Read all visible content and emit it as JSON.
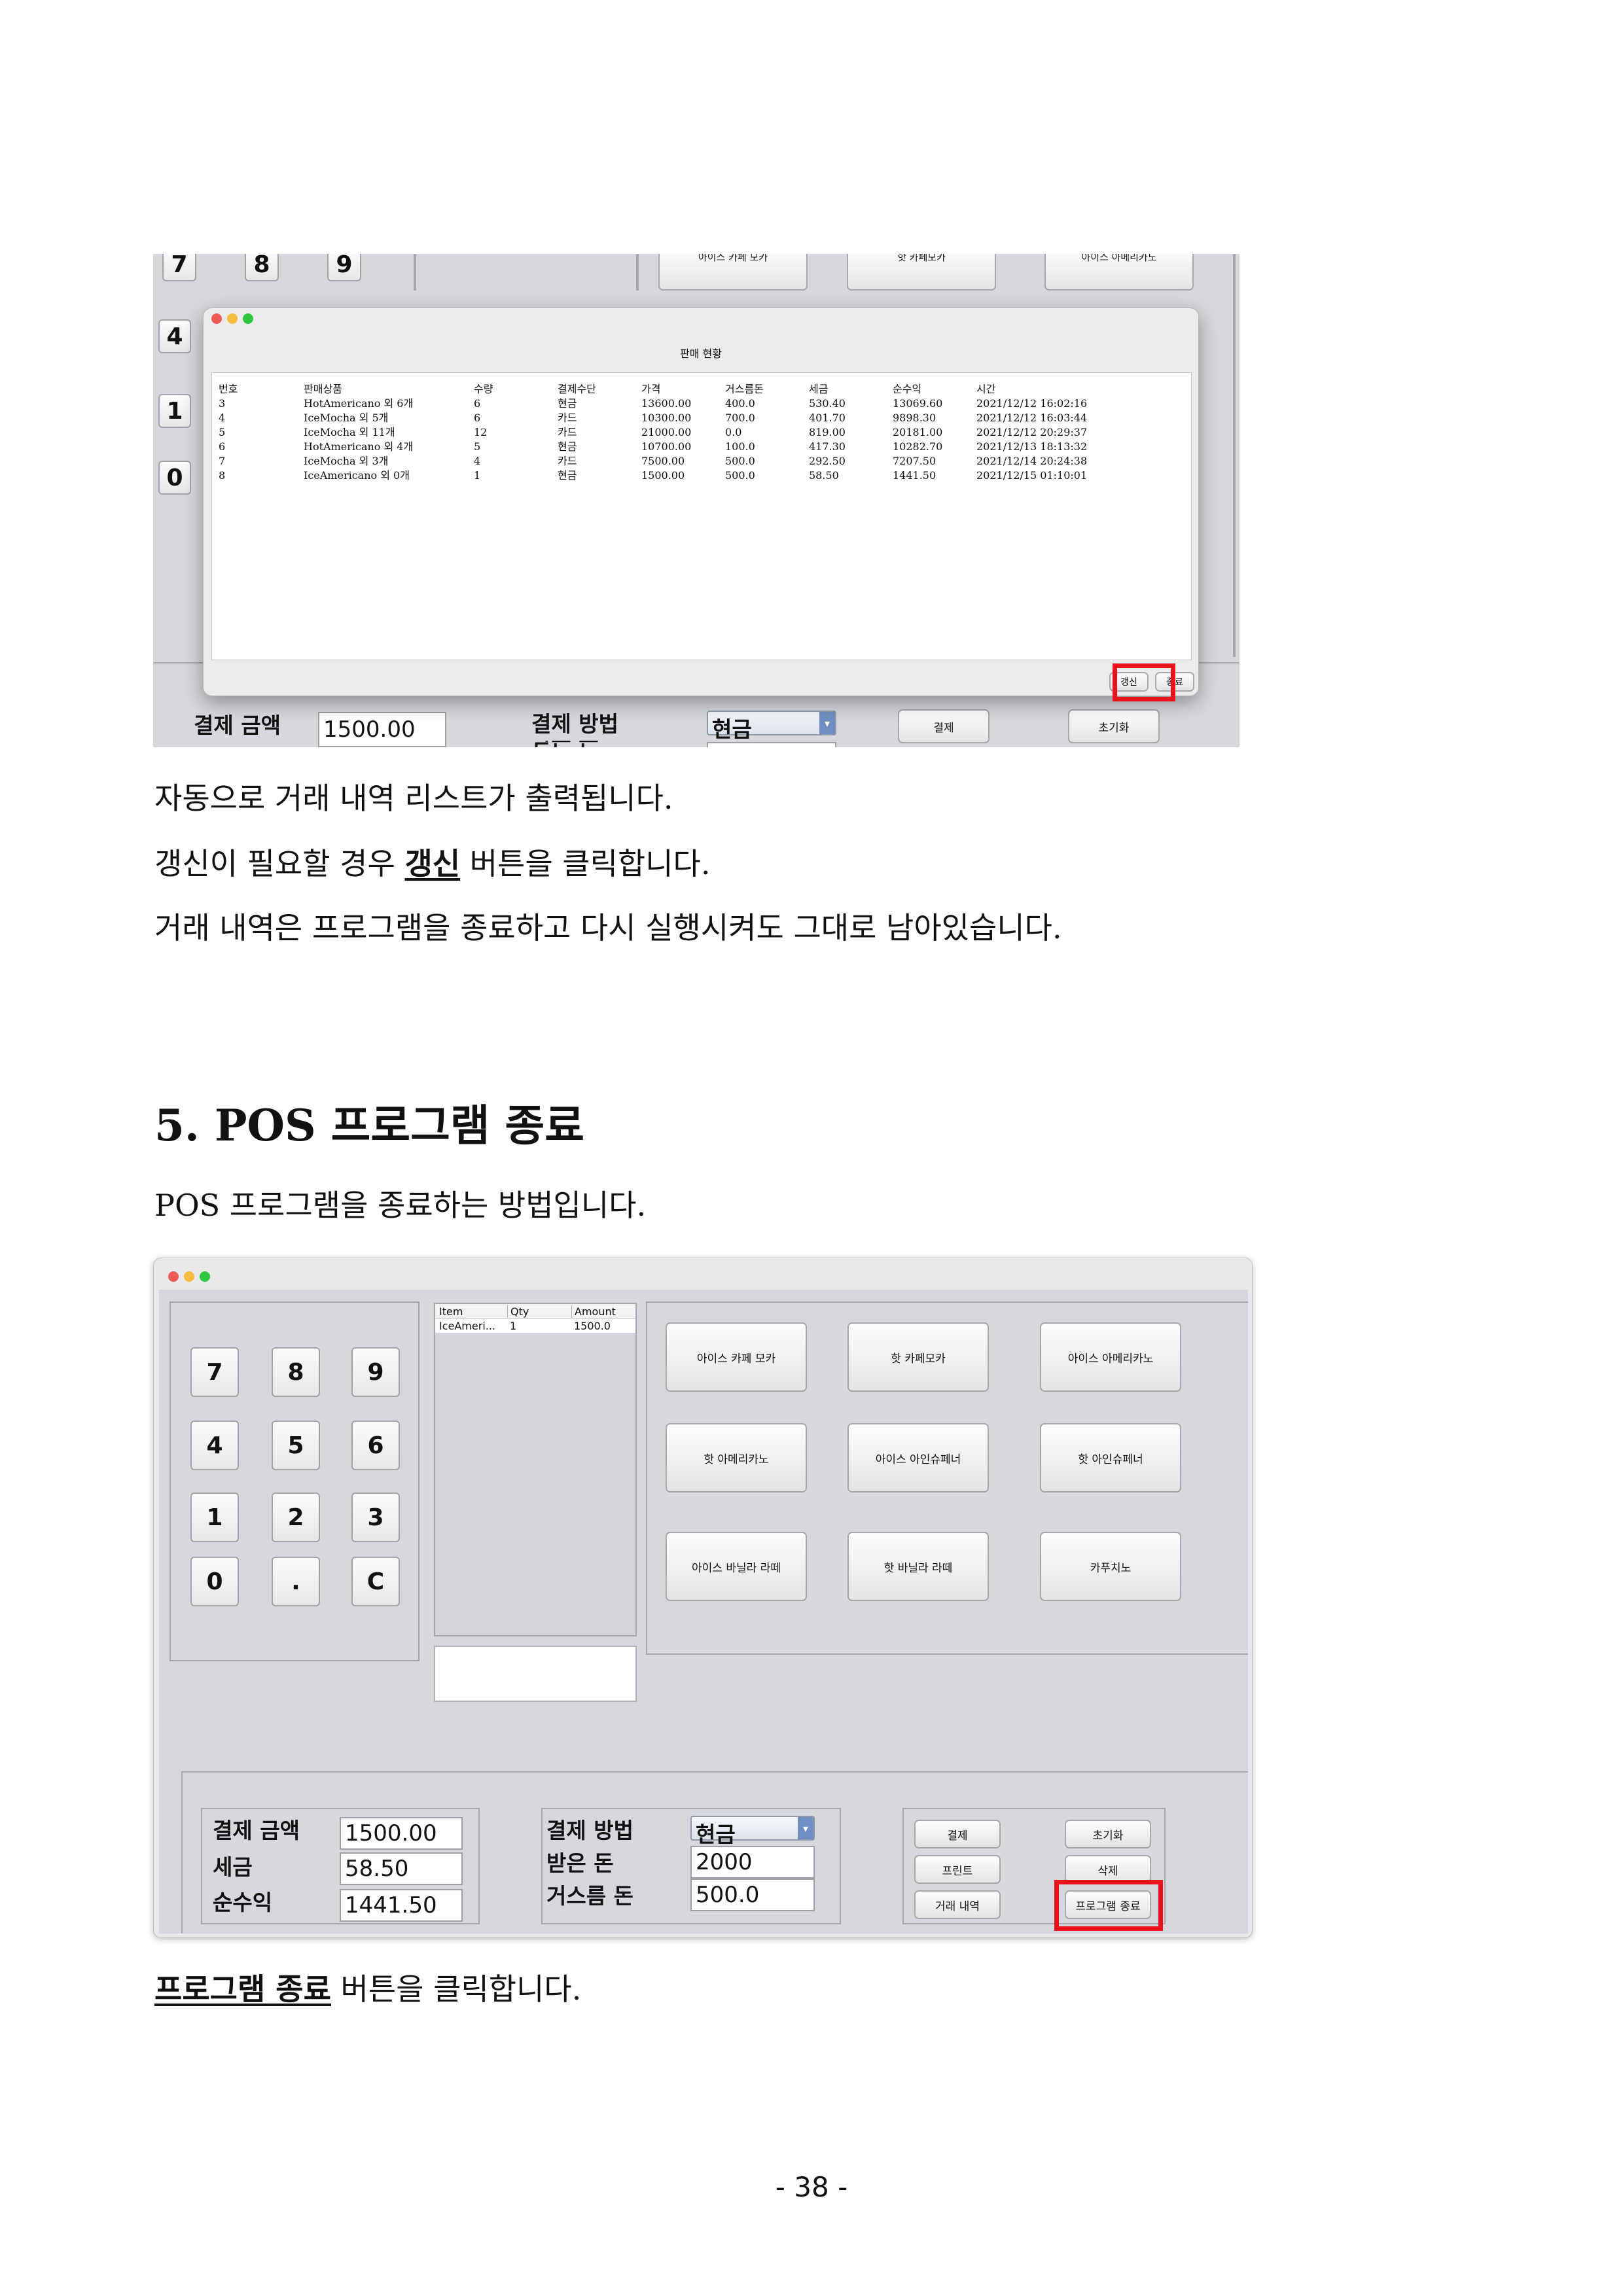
{
  "screenshot1": {
    "keypad_keys": [
      "7",
      "8",
      "9",
      "4",
      "1",
      "0"
    ],
    "menu_top": [
      "아이스 카페 모카",
      "핫 카페모카",
      "아이스 아메리카노"
    ],
    "dialog": {
      "title": "판매 현황",
      "columns": [
        "번호",
        "판매상품",
        "수량",
        "결제수단",
        "가격",
        "거스름돈",
        "세금",
        "순수익",
        "시간"
      ],
      "rows": [
        [
          "3",
          "HotAmericano 외 6개",
          "6",
          "현금",
          "13600.00",
          "400.0",
          "530.40",
          "13069.60",
          "2021/12/12 16:02:16"
        ],
        [
          "4",
          "IceMocha 외 5개",
          "6",
          "카드",
          "10300.00",
          "700.0",
          "401.70",
          "9898.30",
          "2021/12/12 16:03:44"
        ],
        [
          "5",
          "IceMocha 외 11개",
          "12",
          "카드",
          "21000.00",
          "0.0",
          "819.00",
          "20181.00",
          "2021/12/12 20:29:37"
        ],
        [
          "6",
          "HotAmericano 외 4개",
          "5",
          "현금",
          "10700.00",
          "100.0",
          "417.30",
          "10282.70",
          "2021/12/13 18:13:32"
        ],
        [
          "7",
          "IceMocha 외 3개",
          "4",
          "카드",
          "7500.00",
          "500.0",
          "292.50",
          "7207.50",
          "2021/12/14 20:24:38"
        ],
        [
          "8",
          "IceAmericano 외 0개",
          "1",
          "현금",
          "1500.00",
          "500.0",
          "58.50",
          "1441.50",
          "2021/12/15 01:10:01"
        ]
      ],
      "refresh_label": "갱신",
      "close_label": "종료"
    },
    "payment_amount_label": "결제 금액",
    "payment_amount_value": "1500.00",
    "payment_method_label": "결제 방법",
    "payment_method_value": "현금",
    "received_partial": "받은 돈",
    "pay_label": "결제",
    "reset_label": "초기화"
  },
  "paragraph1": {
    "line1": "자동으로 거래 내역 리스트가 출력됩니다.",
    "line2_before": "갱신이 필요할 경우 ",
    "line2_bold": "갱신",
    "line2_after": " 버튼을 클릭합니다.",
    "line3": "거래 내역은 프로그램을 종료하고 다시 실행시켜도 그대로 남아있습니다."
  },
  "section5": {
    "heading": "5. POS 프로그램 종료",
    "intro": "POS 프로그램을 종료하는 방법입니다."
  },
  "screenshot2": {
    "keypad": [
      "7",
      "8",
      "9",
      "4",
      "5",
      "6",
      "1",
      "2",
      "3",
      "0",
      ".",
      "C"
    ],
    "order_table": {
      "headers": [
        "Item",
        "Qty",
        "Amount"
      ],
      "rows": [
        [
          "IceAmeri...",
          "1",
          "1500.0"
        ]
      ]
    },
    "menu": [
      "아이스 카페 모카",
      "핫 카페모카",
      "아이스 아메리카노",
      "핫 아메리카노",
      "아이스 아인슈페너",
      "핫 아인슈페너",
      "아이스 바닐라 라떼",
      "핫 바닐라 라떼",
      "카푸치노"
    ],
    "payment_amount_label": "결제 금액",
    "payment_amount_value": "1500.00",
    "tax_label": "세금",
    "tax_value": "58.50",
    "net_label": "순수익",
    "net_value": "1441.50",
    "payment_method_label": "결제 방법",
    "payment_method_value": "현금",
    "received_label": "받은 돈",
    "received_value": "2000",
    "change_label": "거스름 돈",
    "change_value": "500.0",
    "buttons": {
      "pay": "결제",
      "reset": "초기화",
      "print": "프린트",
      "delete": "삭제",
      "history": "거래 내역",
      "exit": "프로그램 종료"
    }
  },
  "closing": {
    "bold": "프로그램 종료",
    "after": " 버튼을 클릭합니다."
  },
  "page_number": "- 38 -"
}
